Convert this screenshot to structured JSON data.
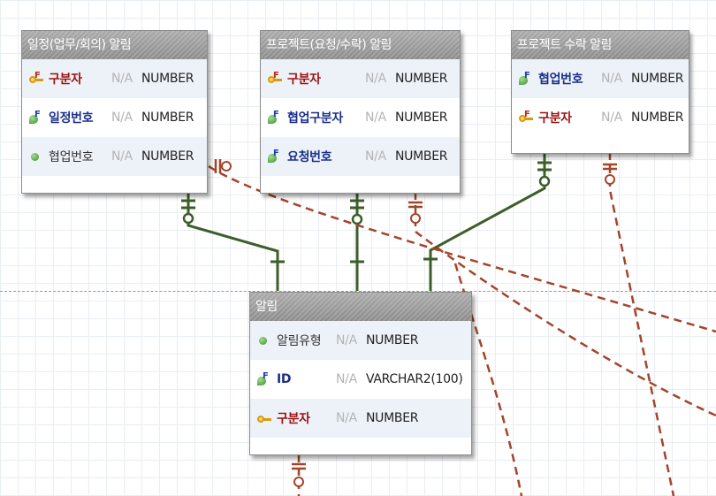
{
  "diagram": {
    "entities": [
      {
        "id": "schedule-alert",
        "title": "일정(업무/회의) 알림",
        "attributes": [
          {
            "name": "구분자",
            "nullable": "N/A",
            "type": "NUMBER",
            "kind": "pk-fk",
            "style": "pk"
          },
          {
            "name": "일정번호",
            "nullable": "N/A",
            "type": "NUMBER",
            "kind": "fk",
            "style": "fk"
          },
          {
            "name": "협업번호",
            "nullable": "N/A",
            "type": "NUMBER",
            "kind": "attr",
            "style": "plain"
          }
        ]
      },
      {
        "id": "project-request-alert",
        "title": "프로젝트(요청/수락) 알림",
        "attributes": [
          {
            "name": "구분자",
            "nullable": "N/A",
            "type": "NUMBER",
            "kind": "pk-fk",
            "style": "pk"
          },
          {
            "name": "협업구분자",
            "nullable": "N/A",
            "type": "NUMBER",
            "kind": "fk",
            "style": "fk"
          },
          {
            "name": "요청번호",
            "nullable": "N/A",
            "type": "NUMBER",
            "kind": "fk",
            "style": "fk"
          }
        ]
      },
      {
        "id": "project-accept-alert",
        "title": "프로젝트 수락 알림",
        "attributes": [
          {
            "name": "협업번호",
            "nullable": "N/A",
            "type": "NUMBER",
            "kind": "fk",
            "style": "fk"
          },
          {
            "name": "구분자",
            "nullable": "N/A",
            "type": "NUMBER",
            "kind": "pk-fk",
            "style": "pk"
          }
        ]
      },
      {
        "id": "alert",
        "title": "알림",
        "attributes": [
          {
            "name": "알림유형",
            "nullable": "N/A",
            "type": "NUMBER",
            "kind": "attr",
            "style": "plain"
          },
          {
            "name": "ID",
            "nullable": "N/A",
            "type": "VARCHAR2(100)",
            "kind": "fk",
            "style": "fk"
          },
          {
            "name": "구분자",
            "nullable": "N/A",
            "type": "NUMBER",
            "kind": "pk",
            "style": "pk"
          }
        ]
      }
    ],
    "colors": {
      "identifying_line": "#3c5e28",
      "non_identifying_line": "#a2452a",
      "header_bg": "#999999",
      "pk_text": "#9b1010",
      "fk_text": "#1a2f8c"
    }
  }
}
